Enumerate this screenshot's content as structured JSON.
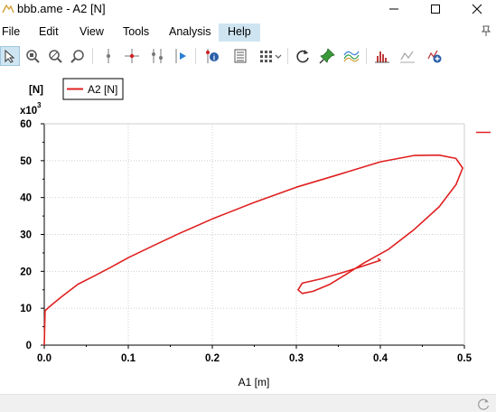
{
  "window": {
    "title": "bbb.ame - A2 [N]",
    "minimize_glyph": "—",
    "maximize_glyph": "☐",
    "close_glyph": "✕"
  },
  "menu": {
    "items": [
      {
        "label": "File"
      },
      {
        "label": "Edit"
      },
      {
        "label": "View"
      },
      {
        "label": "Tools"
      },
      {
        "label": "Analysis"
      },
      {
        "label": "Help",
        "active": true
      }
    ]
  },
  "toolbar": {
    "icons": [
      "select-arrow-icon",
      "zoom-region-icon",
      "zoom-out-icon",
      "zoom-reset-icon",
      "vertical-cursor-icon",
      "cross-cursor-icon",
      "two-cursors-icon",
      "play-cursor-icon",
      "info-icon",
      "table-view-icon",
      "grid-layout-icon",
      "refresh-icon",
      "pin-icon",
      "curves-icon",
      "histogram-icon",
      "chart-add-icon",
      "new-plot-icon"
    ]
  },
  "chart_data": {
    "type": "line",
    "ylabel_unit": "[N]",
    "ylabel_multiplier": "x10",
    "ylabel_exponent": "3",
    "xlabel": "A1 [m]",
    "xlim": [
      0,
      0.5
    ],
    "ylim": [
      0,
      60
    ],
    "x_ticks": [
      "0.0",
      "0.1",
      "0.2",
      "0.3",
      "0.4",
      "0.5"
    ],
    "y_ticks": [
      "0",
      "10",
      "20",
      "30",
      "40",
      "50",
      "60"
    ],
    "grid": true,
    "legend": {
      "placement": "top-left",
      "entries": [
        {
          "name": "A2 [N]",
          "color": "#e02020"
        }
      ]
    },
    "series": [
      {
        "name": "A2 [N]",
        "color": "#e02020",
        "points": [
          [
            0.0,
            0.0
          ],
          [
            0.001,
            9.3
          ],
          [
            0.005,
            10.2
          ],
          [
            0.02,
            13.0
          ],
          [
            0.04,
            16.5
          ],
          [
            0.06,
            18.8
          ],
          [
            0.08,
            21.2
          ],
          [
            0.1,
            23.7
          ],
          [
            0.13,
            27.0
          ],
          [
            0.16,
            30.2
          ],
          [
            0.2,
            34.2
          ],
          [
            0.25,
            38.7
          ],
          [
            0.3,
            42.8
          ],
          [
            0.35,
            46.2
          ],
          [
            0.4,
            49.7
          ],
          [
            0.44,
            51.4
          ],
          [
            0.47,
            51.5
          ],
          [
            0.49,
            50.6
          ],
          [
            0.498,
            48.0
          ],
          [
            0.49,
            43.5
          ],
          [
            0.47,
            37.5
          ],
          [
            0.44,
            31.3
          ],
          [
            0.41,
            26.0
          ],
          [
            0.38,
            22.2
          ],
          [
            0.36,
            19.3
          ],
          [
            0.34,
            16.5
          ],
          [
            0.32,
            14.6
          ],
          [
            0.307,
            14.0
          ],
          [
            0.302,
            15.0
          ],
          [
            0.307,
            16.8
          ],
          [
            0.33,
            18.0
          ],
          [
            0.36,
            20.0
          ],
          [
            0.38,
            21.5
          ],
          [
            0.4,
            23.0
          ],
          [
            0.397,
            23.5
          ]
        ]
      }
    ]
  },
  "status": {
    "icon": "busy-indicator-icon"
  }
}
